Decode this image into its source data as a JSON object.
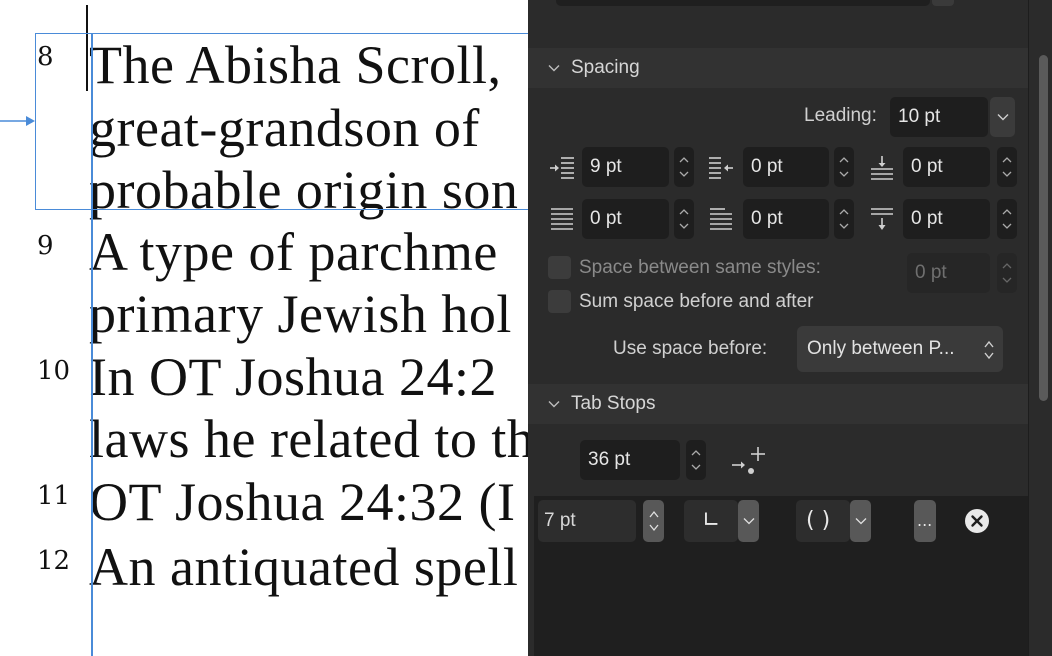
{
  "document": {
    "footnotes": [
      {
        "num": "8",
        "text": "The Abisha Scroll,"
      },
      {
        "num": "",
        "text": "great-grandson  of"
      },
      {
        "num": "",
        "text": "probable origin son"
      },
      {
        "num": "9",
        "text": "A type of parchme"
      },
      {
        "num": "",
        "text": "primary Jewish hol"
      },
      {
        "num": "10",
        "text": "In OT Joshua 24:2"
      },
      {
        "num": "",
        "text": "laws he related to th"
      },
      {
        "num": "11",
        "text": "OT Joshua 24:32 (I"
      },
      {
        "num": "12",
        "text": "An antiquated spell"
      }
    ]
  },
  "panel": {
    "spacing": {
      "title": "Spacing",
      "leading_label": "Leading:",
      "leading_value": "10 pt",
      "left_indent": "9 pt",
      "right_indent": "0 pt",
      "space_before": "0 pt",
      "first_line": "0 pt",
      "last_line": "0 pt",
      "space_after": "0 pt",
      "space_between_label": "Space between same styles:",
      "space_between_value": "0 pt",
      "sum_space_label": "Sum space before and after",
      "use_space_label": "Use space before:",
      "use_space_value": "Only between P..."
    },
    "tab_stops": {
      "title": "Tab Stops",
      "default_value": "36 pt",
      "stops": [
        {
          "position": "7 pt",
          "alignment_glyph": "∟",
          "leader_glyph": "( )",
          "more": "..."
        }
      ]
    }
  },
  "colors": {
    "selection_blue": "#4a8bd8",
    "panel_bg": "#2b2b2b",
    "field_bg": "#1e1e1e"
  }
}
